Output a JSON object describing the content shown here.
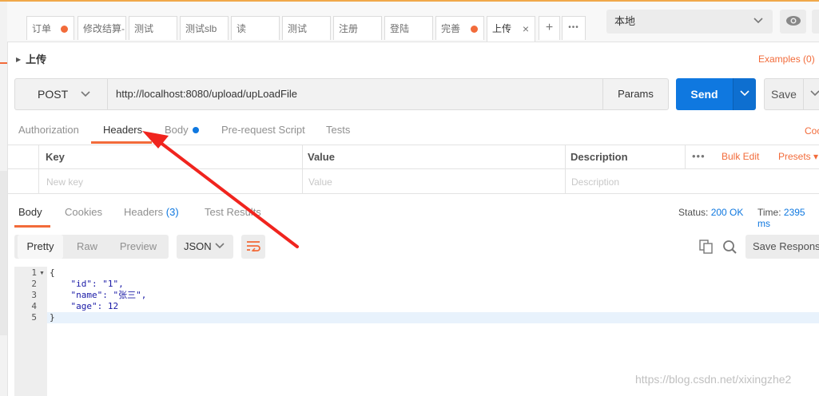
{
  "tabs": [
    {
      "label": "订单",
      "state": "dot"
    },
    {
      "label": "修改结算-",
      "state": "plain"
    },
    {
      "label": "测试",
      "state": "plain"
    },
    {
      "label": "测试slb",
      "state": "plain"
    },
    {
      "label": "读",
      "state": "plain"
    },
    {
      "label": "测试",
      "state": "plain"
    },
    {
      "label": "注册",
      "state": "plain"
    },
    {
      "label": "登陆",
      "state": "plain"
    },
    {
      "label": "完善",
      "state": "dot"
    },
    {
      "label": "上传",
      "state": "active"
    }
  ],
  "tab_actions": {
    "add_icon": "+",
    "more_icon": "•••",
    "close_icon": "×"
  },
  "environment": {
    "selected": "本地",
    "chevron": "⌄"
  },
  "request": {
    "name": "上传",
    "examples": "Examples (0)",
    "method": "POST",
    "url": "http://localhost:8080/upload/upLoadFile",
    "params_label": "Params",
    "send_label": "Send",
    "save_label": "Save"
  },
  "request_tabs": {
    "authorization": "Authorization",
    "headers": "Headers",
    "body": "Body",
    "prerequest": "Pre-request Script",
    "tests": "Tests",
    "cookies": "Coo"
  },
  "headers_table": {
    "col_key": "Key",
    "col_value": "Value",
    "col_description": "Description",
    "more": "•••",
    "bulk_edit": "Bulk Edit",
    "presets": "Presets ▾",
    "placeholder_key": "New key",
    "placeholder_value": "Value",
    "placeholder_description": "Description"
  },
  "response_tabs": {
    "body": "Body",
    "cookies": "Cookies",
    "headers": "Headers",
    "headers_count": "(3)",
    "test_results": "Test Results"
  },
  "response_status": {
    "status_label": "Status:",
    "status_value": "200 OK",
    "time_label": "Time:",
    "time_value": "2395 ms"
  },
  "response_toolbar": {
    "pretty": "Pretty",
    "raw": "Raw",
    "preview": "Preview",
    "format": "JSON",
    "save_response": "Save Response"
  },
  "code": {
    "line_numbers": [
      "1",
      "2",
      "3",
      "4",
      "5"
    ],
    "lines": [
      "{",
      "    \"id\": \"1\",",
      "    \"name\": \"张三\",",
      "    \"age\": 12",
      "}"
    ]
  },
  "watermark": "https://blog.csdn.net/xixingzhe2",
  "colors": {
    "accent": "#f26b3a",
    "primary": "#0f78e0"
  }
}
